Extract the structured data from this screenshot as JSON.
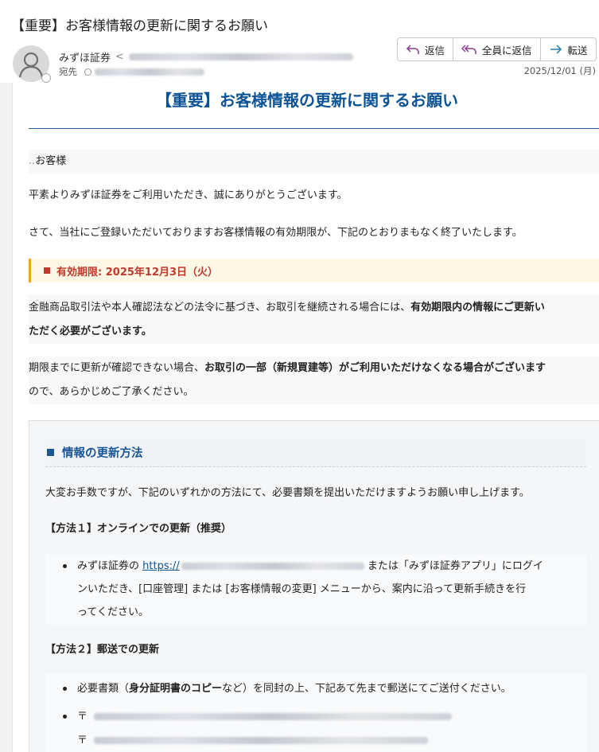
{
  "email": {
    "subject": "【重要】お客様情報の更新に関するお願い",
    "sender_name": "みずほ証券",
    "to_label": "宛先",
    "date": "2025/12/01 (月)"
  },
  "actions": {
    "reply": "返信",
    "reply_all": "全員に返信",
    "forward": "転送"
  },
  "body": {
    "heading": "【重要】お客様情報の更新に関するお願い",
    "salutation": "お客様",
    "greeting": "平素よりみずほ証券をご利用いただき、誠にありがとうございます。",
    "notice": "さて、当社にご登録いただいておりますお客様情報の有効期限が、下記のとおりまもなく終了いたします。",
    "deadline": "有効期限: 2025年12月3日（火）",
    "law_text_1a": "金融商品取引法や本人確認法などの法令に基づき、お取引を継続される場合には、",
    "law_text_1b": "有効期限内の情報にご更新い",
    "law_text_2": "ただく必要がございます。",
    "warn_1a": "期限までに更新が確認できない場合、",
    "warn_1b": "お取引の一部（新規買建等）がご利用いただけなくなる場合がございます",
    "warn_2": "ので、あらかじめご了承ください。"
  },
  "update_section": {
    "title": "情報の更新方法",
    "intro": "大変お手数ですが、下記のいずれかの方法にて、必要書類を提出いただけますようお願い申し上げます。",
    "method1_title": "【方法１】オンラインでの更新（推奨）",
    "method1_line1a": "みずほ証券の ",
    "method1_link": "https://",
    "method1_line1b": " または「みずほ証券アプリ」にログイ",
    "method1_line2": "ンいただき、[口座管理] または [お客様情報の変更] メニューから、案内に沿って更新手続きを行",
    "method1_line3": "ってください。",
    "method2_title": "【方法２】郵送での更新",
    "method2_line1a": "必要書類（",
    "method2_line1b": "身分証明書のコピー",
    "method2_line1c": "など）を同封の上、下記あて先まで郵送にてご送付ください。",
    "postal_mark_1": "〒",
    "postal_mark_2": "〒"
  }
}
